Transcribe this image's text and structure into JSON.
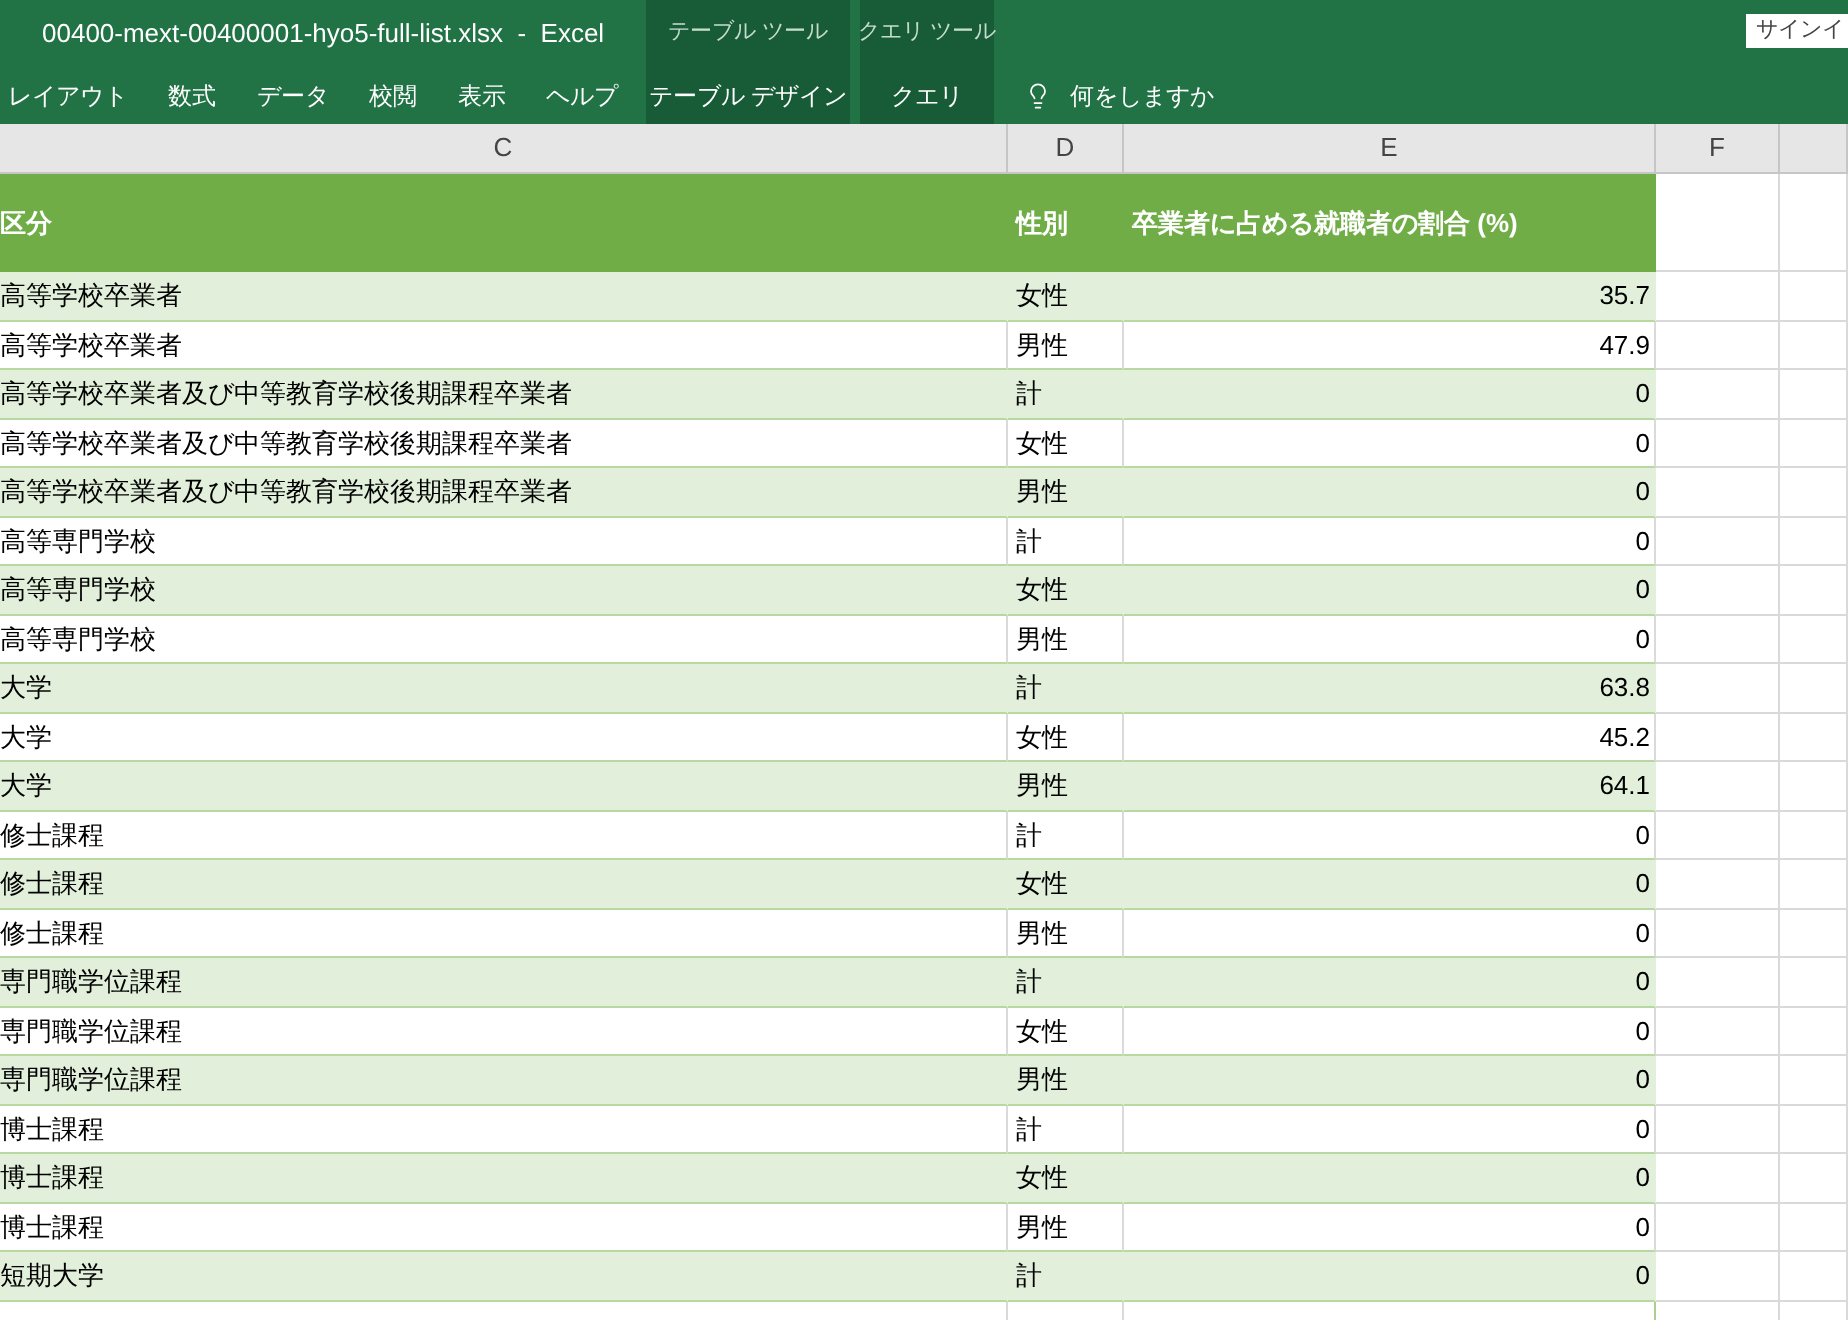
{
  "title_bar": {
    "title": "00400-mext-00400001-hyo5-full-list.xlsx  -  Excel",
    "tool_groups": [
      {
        "label": "テーブル ツール"
      },
      {
        "label": "クエリ ツール"
      }
    ],
    "sign_in": "サインイ"
  },
  "ribbon": {
    "tabs": [
      {
        "label": "レイアウト",
        "kind": "standard"
      },
      {
        "label": "数式",
        "kind": "standard"
      },
      {
        "label": "データ",
        "kind": "standard"
      },
      {
        "label": "校閲",
        "kind": "standard"
      },
      {
        "label": "表示",
        "kind": "standard"
      },
      {
        "label": "ヘルプ",
        "kind": "standard"
      },
      {
        "label": "テーブル デザイン",
        "kind": "context"
      },
      {
        "label": "クエリ",
        "kind": "context"
      }
    ],
    "tell_me": {
      "placeholder": "何をしますか"
    }
  },
  "column_headers": [
    "C",
    "D",
    "E",
    "F"
  ],
  "table": {
    "columns": [
      "区分",
      "性別",
      "卒業者に占める就職者の割合 (%)"
    ],
    "rows": [
      [
        "高等学校卒業者",
        "女性",
        "35.7"
      ],
      [
        "高等学校卒業者",
        "男性",
        "47.9"
      ],
      [
        "高等学校卒業者及び中等教育学校後期課程卒業者",
        "計",
        "0"
      ],
      [
        "高等学校卒業者及び中等教育学校後期課程卒業者",
        "女性",
        "0"
      ],
      [
        "高等学校卒業者及び中等教育学校後期課程卒業者",
        "男性",
        "0"
      ],
      [
        "高等専門学校",
        "計",
        "0"
      ],
      [
        "高等専門学校",
        "女性",
        "0"
      ],
      [
        "高等専門学校",
        "男性",
        "0"
      ],
      [
        "大学",
        "計",
        "63.8"
      ],
      [
        "大学",
        "女性",
        "45.2"
      ],
      [
        "大学",
        "男性",
        "64.1"
      ],
      [
        "修士課程",
        "計",
        "0"
      ],
      [
        "修士課程",
        "女性",
        "0"
      ],
      [
        "修士課程",
        "男性",
        "0"
      ],
      [
        "専門職学位課程",
        "計",
        "0"
      ],
      [
        "専門職学位課程",
        "女性",
        "0"
      ],
      [
        "専門職学位課程",
        "男性",
        "0"
      ],
      [
        "博士課程",
        "計",
        "0"
      ],
      [
        "博士課程",
        "女性",
        "0"
      ],
      [
        "博士課程",
        "男性",
        "0"
      ],
      [
        "短期大学",
        "計",
        "0"
      ]
    ]
  }
}
